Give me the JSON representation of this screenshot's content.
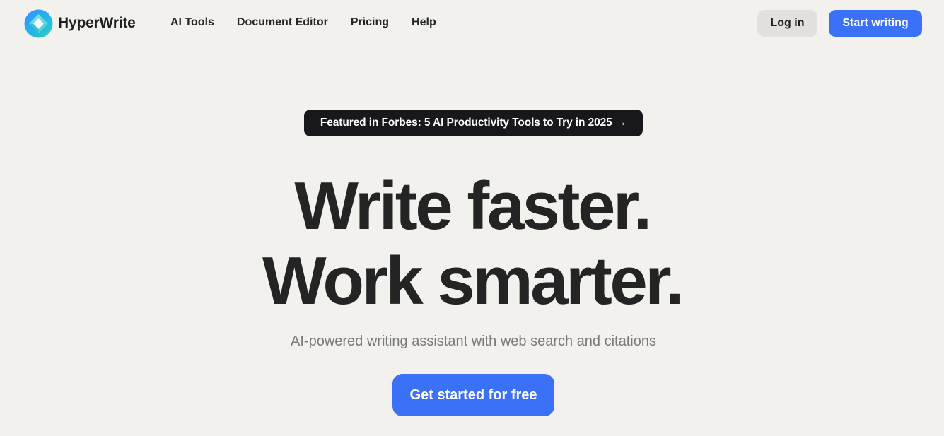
{
  "nav": {
    "brand": "HyperWrite",
    "logo_icon": "hyperwrite-logo-icon",
    "links": [
      "AI Tools",
      "Document Editor",
      "Pricing",
      "Help"
    ],
    "login_label": "Log in",
    "start_label": "Start writing"
  },
  "hero": {
    "badge_text": "Featured in Forbes: 5 AI Productivity Tools to Try in 2025",
    "badge_arrow": "→",
    "headline_line1": "Write faster.",
    "headline_line2": "Work smarter.",
    "subtitle": "AI-powered writing assistant with web search and citations",
    "cta_label": "Get started for free"
  },
  "colors": {
    "background": "#f2f1ee",
    "accent": "#3b71f6",
    "badge_bg": "#18181b",
    "login_bg": "#e2e1de",
    "text": "#242424",
    "muted": "#7a7a7a"
  }
}
